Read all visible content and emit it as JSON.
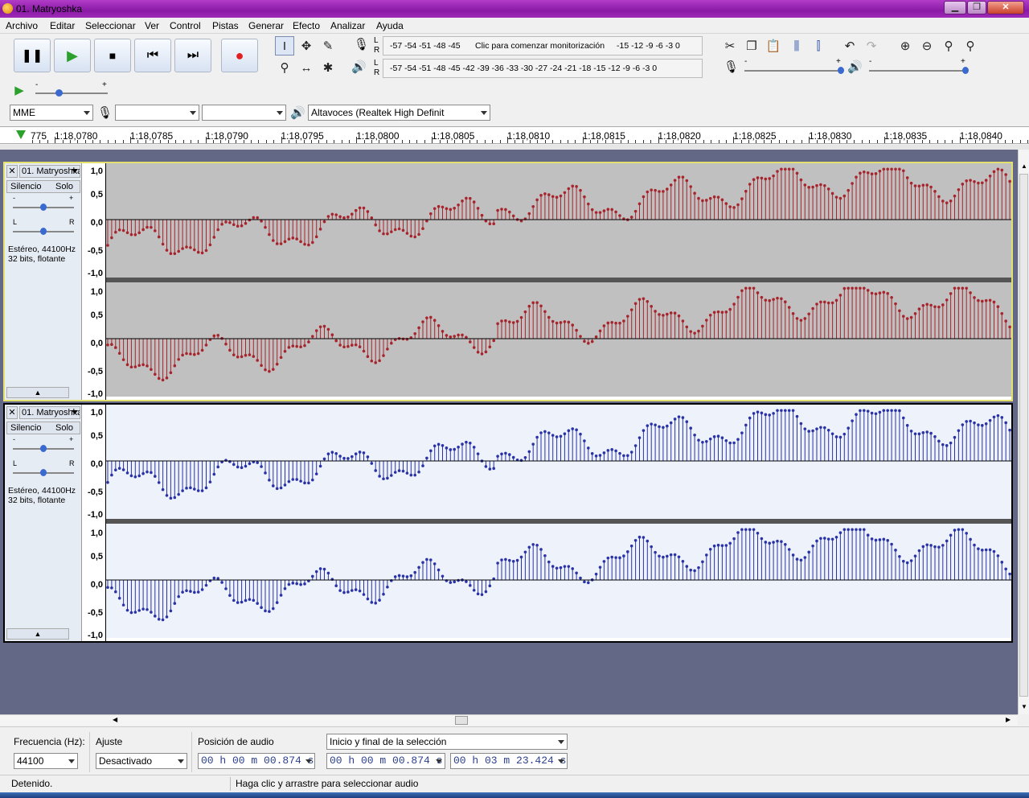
{
  "window": {
    "title": "01. Matryoshka"
  },
  "menu": [
    "Archivo",
    "Editar",
    "Seleccionar",
    "Ver",
    "Control",
    "Pistas",
    "Generar",
    "Efecto",
    "Analizar",
    "Ayuda"
  ],
  "meter": {
    "rec_scale": "-57 -54 -51 -48 -45",
    "rec_prompt": "Clic para comenzar monitorización",
    "rec_scale_tail": "-15 -12  -9  -6  -3  0",
    "play_scale": "-57 -54 -51 -48 -45 -42 -39 -36 -33 -30 -27 -24 -21 -18 -15 -12  -9  -6  -3  0",
    "L": "L",
    "R": "R",
    "minus": "-",
    "plus": "+"
  },
  "device": {
    "host": "MME",
    "rec_device": "",
    "rec_channels": "",
    "play_device": "Altavoces (Realtek High Definit"
  },
  "ruler": {
    "labels": [
      "775",
      "1:18,0780",
      "1:18,0785",
      "1:18,0790",
      "1:18,0795",
      "1:18,0800",
      "1:18,0805",
      "1:18,0810",
      "1:18,0815",
      "1:18,0820",
      "1:18,0825",
      "1:18,0830",
      "1:18,0835",
      "1:18,0840"
    ]
  },
  "tracks": [
    {
      "name": "01. Matryoshka",
      "close": "✕",
      "mute": "Silencio",
      "solo": "Solo",
      "info_line1": "Estéreo, 44100Hz",
      "info_line2": "32 bits, flotante",
      "gain_min": "-",
      "gain_max": "+",
      "pan_l": "L",
      "pan_r": "R",
      "scale": [
        "1,0",
        "0,5",
        "0,0",
        "-0,5",
        "-1,0"
      ],
      "color": "#a8242c",
      "background": "#c0c0c0",
      "selected": true
    },
    {
      "name": "01. Matryoshka",
      "close": "✕",
      "mute": "Silencio",
      "solo": "Solo",
      "info_line1": "Estéreo, 44100Hz",
      "info_line2": "32 bits, flotante",
      "gain_min": "-",
      "gain_max": "+",
      "pan_l": "L",
      "pan_r": "R",
      "scale": [
        "1,0",
        "0,5",
        "0,0",
        "-0,5",
        "-1,0"
      ],
      "color": "#2a32a8",
      "background": "#eef3fb",
      "selected": false
    }
  ],
  "selection": {
    "rate_label": "Frecuencia (Hz):",
    "rate_value": "44100",
    "snap_label": "Ajuste",
    "snap_value": "Desactivado",
    "pos_label": "Posición de audio",
    "pos_value": "00 h 00 m 00.874 s",
    "range_label": "Inicio y final de la selección",
    "start_value": "00 h 00 m 00.874 s",
    "end_value": "00 h 03 m 23.424 s"
  },
  "status": {
    "state": "Detenido.",
    "hint": "Haga clic y arrastre para seleccionar audio"
  },
  "colors": {
    "accent": "#8a1aa6",
    "track_bg": "#636887"
  }
}
